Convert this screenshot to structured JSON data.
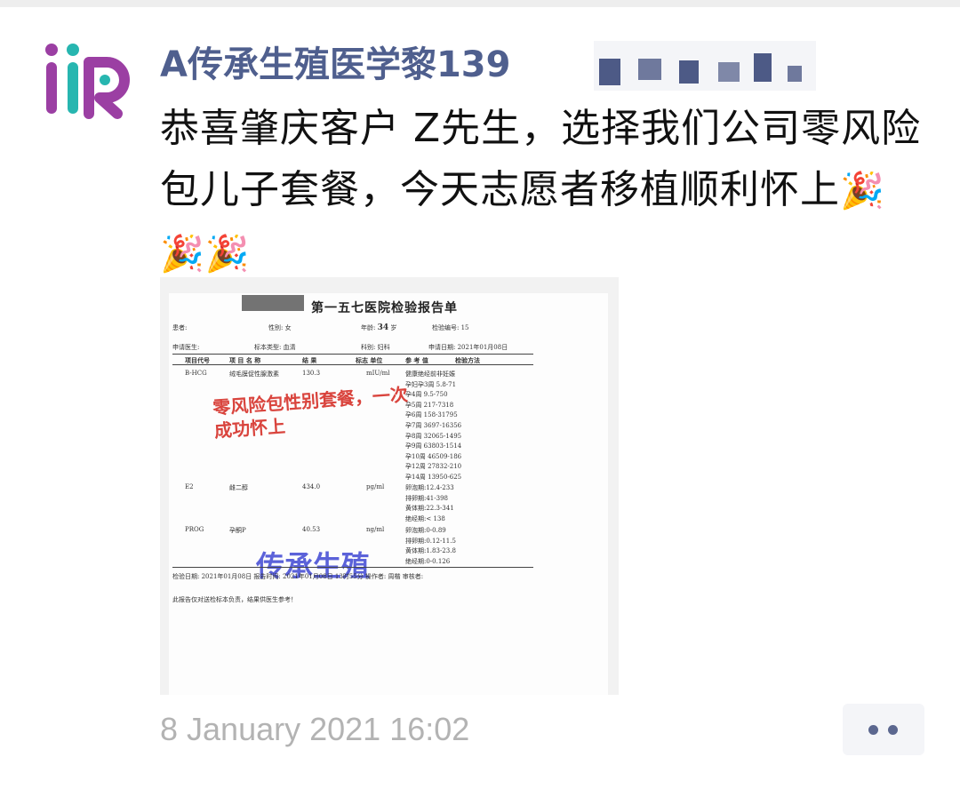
{
  "post": {
    "author": "A传承生殖医学黎139",
    "text": "恭喜肇庆客户 Z先生，选择我们公司零风险包儿子套餐，今天志愿者移植顺利怀上",
    "emoji": [
      "🎉",
      "🎉",
      "🎉"
    ],
    "timestamp": "8 January 2021 16:02"
  },
  "report": {
    "title": "第一五七医院检验报告单",
    "patient_label": "患者:",
    "gender_label": "性别: 女",
    "age_label": "年龄:",
    "age_value": "34",
    "age_unit": "岁",
    "test_no": "检验编号: 15",
    "doctor_label": "申请医生:",
    "specimen": "标本类型: 血清",
    "dept": "科别: 妇科",
    "apply_date": "申请日期: 2021年01月08日",
    "headers": [
      "项目代号",
      "项 目 名 称",
      "结 果",
      "标志 单位",
      "参 考 值",
      "检验方法"
    ],
    "rows": [
      {
        "code": "B-HCG",
        "name": "绒毛膜促性腺激素",
        "result": "130.3",
        "unit": "mIU/ml",
        "refs": [
          "健康绝经前非妊娠",
          "孕妇孕3周 5.8-71",
          "孕4周 9.5-750",
          "孕5周 217-7318",
          "孕6周 158-31795",
          "孕7周 3697-16356",
          "孕8周 32065-1495",
          "孕9周 63803-1514",
          "孕10周 46509-186",
          "孕12周 27832-210",
          "孕14周 13950-625"
        ]
      },
      {
        "code": "E2",
        "name": "雌二醇",
        "result": "434.0",
        "unit": "pg/ml",
        "refs": [
          "卵泡期:12.4-233",
          "排卵期:41-398",
          "黄体期:22.3-341",
          "绝经期:< 138"
        ]
      },
      {
        "code": "PROG",
        "name": "孕酮P",
        "result": "40.53",
        "unit": "ng/ml",
        "refs": [
          "卵泡期:0-0.89",
          "排卵期:0.12-11.5",
          "黄体期:1.83-23.8",
          "绝经期:0-0.126"
        ]
      }
    ],
    "footer": "检验日期:   2021年01月08日   报告时间:  2021年01月08日 13时55分   操作者:  周楷   审核者:",
    "disclaimer": "此报告仅对送检标本负责，结果供医生参考！",
    "overlay_red": "零风险包性别套餐，一次成功怀上",
    "overlay_blue": "传承生殖"
  },
  "colors": {
    "name": "#4f5f8e",
    "timestamp": "#b3b3b3",
    "red_overlay": "#d9443d",
    "blue_overlay": "#5b62d9"
  },
  "icons": {
    "avatar": "iir-logo-icon",
    "more": "more-dots-icon"
  }
}
